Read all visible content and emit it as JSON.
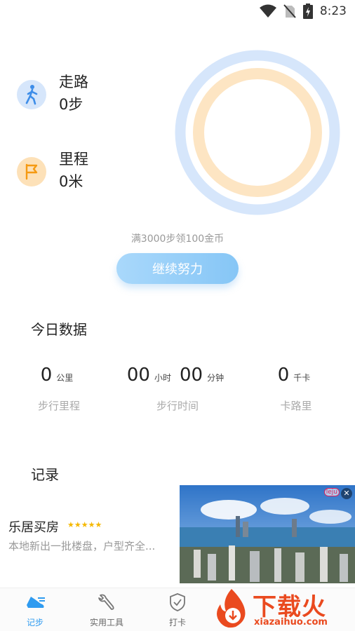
{
  "status_bar": {
    "time": "8:23"
  },
  "stats": {
    "walk": {
      "label": "走路",
      "value": "0步"
    },
    "mileage": {
      "label": "里程",
      "value": "0米"
    }
  },
  "goal": {
    "text": "满3000步领100金币",
    "button_label": "继续努力"
  },
  "today": {
    "title": "今日数据",
    "distance": {
      "value": "0",
      "unit": "公里",
      "caption": "步行里程"
    },
    "time": {
      "hours": "00",
      "hours_unit": "小时",
      "minutes": "00",
      "minutes_unit": "分钟",
      "caption": "步行时间"
    },
    "calories": {
      "value": "0",
      "unit": "千卡",
      "caption": "卡路里"
    }
  },
  "records": {
    "title": "记录"
  },
  "ad": {
    "title": "乐居买房",
    "stars": "★★★★★",
    "description": "本地新出一批楼盘，户型齐全...",
    "brand": "leju",
    "close": "✕"
  },
  "bottom_nav": {
    "items": [
      {
        "label": "记步",
        "icon": "shoe-icon",
        "active": true
      },
      {
        "label": "实用工具",
        "icon": "wrench-icon",
        "active": false
      },
      {
        "label": "打卡",
        "icon": "shield-check-icon",
        "active": false
      }
    ]
  },
  "watermark": {
    "text": "下载火",
    "url": "xiazaihuo.com"
  },
  "colors": {
    "accent": "#2f9bf0",
    "ring_outer": "#d6e6fb",
    "ring_inner": "#fde5c3",
    "button": "#9fd3fa"
  }
}
